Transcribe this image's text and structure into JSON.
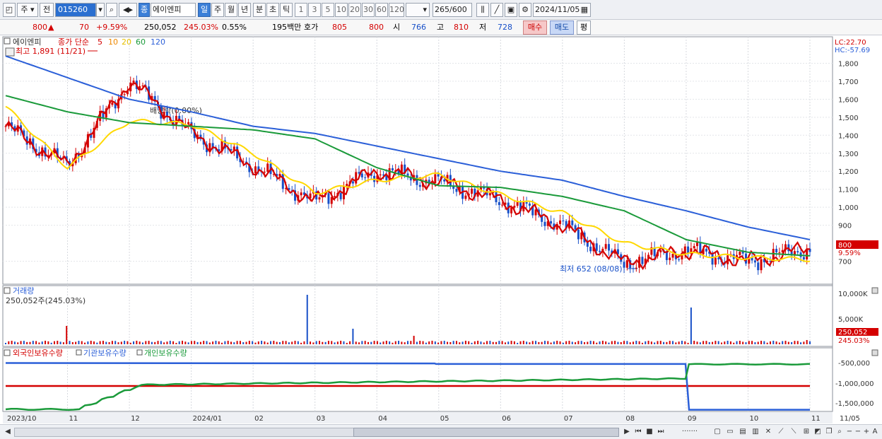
{
  "toolbar": {
    "market_label": "주",
    "prev_label": "전",
    "stock_code": "015260",
    "stock_name": "에이엔피",
    "period_day": "일",
    "period_week": "주",
    "period_month": "월",
    "period_year": "년",
    "period_minute": "분",
    "period_second": "초",
    "period_tick": "틱",
    "intervals": [
      "1",
      "3",
      "5",
      "10",
      "20",
      "30",
      "60",
      "120"
    ],
    "bar_count": "265",
    "bar_total": "/600",
    "date": "2024/11/05"
  },
  "quote": {
    "price": "800",
    "change_arrow": "▲",
    "change": "70",
    "change_pct": "+9.59%",
    "volume": "250,052",
    "volume_pct": "245.03%",
    "turnover_pct": "0.55%",
    "trade_value": "195백만",
    "bid_label": "호가",
    "bid1": "805",
    "bid2": "800",
    "open_label": "시",
    "open": "766",
    "high_label": "고",
    "high": "810",
    "low_label": "저",
    "low": "728",
    "buy_button": "매수",
    "sell_button": "매도",
    "eval_button": "평"
  },
  "price_panel": {
    "stock_label": "에이엔피",
    "ma_label": "종가 단순",
    "ma_periods": [
      "5",
      "10",
      "20",
      "60",
      "120"
    ],
    "ma_colors": [
      "#d40000",
      "#ee8800",
      "#ffd800",
      "#1a9a3a",
      "#2b5fd8"
    ],
    "high_annotation": "최고 1,891 (11/21)",
    "low_annotation": "최저 652 (08/08)",
    "dividend_annotation": "배당락(0.00%)",
    "lc_label": "LC:22.70",
    "hc_label": "HC:-57.69",
    "current_price_tag": "800",
    "current_pct_tag": "9.59%",
    "y_ticks": [
      "1,800",
      "1,700",
      "1,600",
      "1,500",
      "1,400",
      "1,300",
      "1,200",
      "1,100",
      "1,000",
      "900",
      "700"
    ]
  },
  "volume_panel": {
    "title": "거래량",
    "value_label": "250,052주(245.03%)",
    "y_ticks": [
      "10,000K",
      "5,000K"
    ],
    "current_tag": "250,052",
    "current_pct_tag": "245.03%"
  },
  "holdings_panel": {
    "legend": [
      "외국인보유수량",
      "기관보유수량",
      "개인보유수량"
    ],
    "legend_colors": [
      "#d40000",
      "#2b5fd8",
      "#1a9a3a"
    ],
    "y_ticks": [
      "-500,000",
      "-1,000,000",
      "-1,500,000"
    ]
  },
  "x_axis": {
    "labels": [
      "2023/10",
      "11",
      "12",
      "2024/01",
      "02",
      "03",
      "04",
      "05",
      "06",
      "07",
      "08",
      "09",
      "10",
      "11",
      "11/05"
    ]
  },
  "chart_data": {
    "type": "line",
    "x": [
      "2023/10",
      "11",
      "12",
      "2024/01",
      "02",
      "03",
      "04",
      "05",
      "06",
      "07",
      "08",
      "09",
      "10",
      "11"
    ],
    "series": [
      {
        "name": "120",
        "values": [
          1840,
          1720,
          1600,
          1530,
          1450,
          1410,
          1340,
          1270,
          1200,
          1150,
          1060,
          980,
          890,
          820
        ]
      },
      {
        "name": "60",
        "values": [
          1620,
          1530,
          1470,
          1450,
          1430,
          1380,
          1220,
          1120,
          1110,
          1060,
          980,
          820,
          750,
          730
        ]
      },
      {
        "name": "20",
        "values": [
          1560,
          1220,
          1480,
          1460,
          1300,
          1080,
          1150,
          1180,
          1070,
          970,
          800,
          740,
          720,
          710
        ]
      },
      {
        "name": "5",
        "values": [
          1450,
          1230,
          1700,
          1410,
          1230,
          1030,
          1200,
          1140,
          1040,
          900,
          690,
          760,
          700,
          770
        ]
      }
    ],
    "ylim": [
      600,
      1900
    ],
    "price_high": 1891,
    "price_low": 652,
    "last_close": 800
  }
}
